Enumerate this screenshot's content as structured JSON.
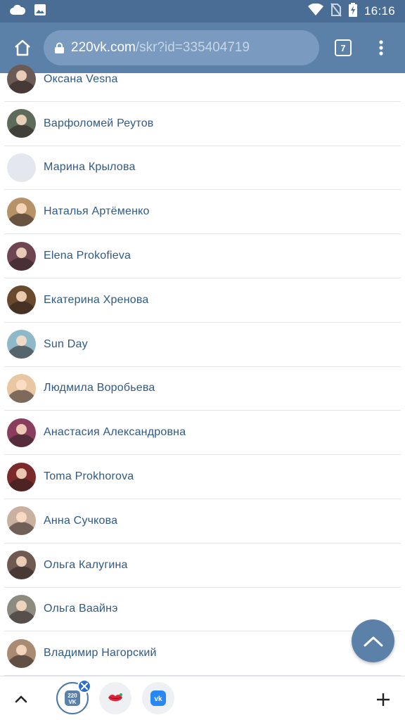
{
  "status_bar": {
    "time": "16:16",
    "icons": [
      "cloud-icon",
      "image-icon",
      "wifi-icon",
      "no-sim-icon",
      "battery-charging-icon"
    ]
  },
  "browser": {
    "url_host": "220vk.com",
    "url_path": "/skr?id=335404719",
    "tab_count": "7"
  },
  "contacts": [
    {
      "name": "Оксана Vesna",
      "avatar_color": "#6b5a55"
    },
    {
      "name": "Варфоломей Реутов",
      "avatar_color": "#5e6a5a"
    },
    {
      "name": "Марина Крылова",
      "avatar_color": "#e4e8ee"
    },
    {
      "name": "Наталья Артёменко",
      "avatar_color": "#b79268"
    },
    {
      "name": "Elena Prokofieva",
      "avatar_color": "#6e4652"
    },
    {
      "name": "Екатерина Хренова",
      "avatar_color": "#6a4a2e"
    },
    {
      "name": "Sun Day",
      "avatar_color": "#8fb8c9"
    },
    {
      "name": "Людмила Воробьева",
      "avatar_color": "#e8c7a2"
    },
    {
      "name": "Анастасия Александровна",
      "avatar_color": "#8a3e5e"
    },
    {
      "name": "Toma Prokhorova",
      "avatar_color": "#7a2a2a"
    },
    {
      "name": "Анна Сучкова",
      "avatar_color": "#c9b0a0"
    },
    {
      "name": "Ольга Калугина",
      "avatar_color": "#6e5a50"
    },
    {
      "name": "Ольга Ваайнэ",
      "avatar_color": "#8d8a80"
    },
    {
      "name": "Владимир Нагорский",
      "avatar_color": "#a98a72"
    }
  ],
  "bottom_bar": {
    "app_220vk_label": "220 VK",
    "vk_label": "vk"
  },
  "colors": {
    "status_bar": "#4a6d96",
    "toolbar": "#5b81a9",
    "link_text": "#2f5a86"
  }
}
